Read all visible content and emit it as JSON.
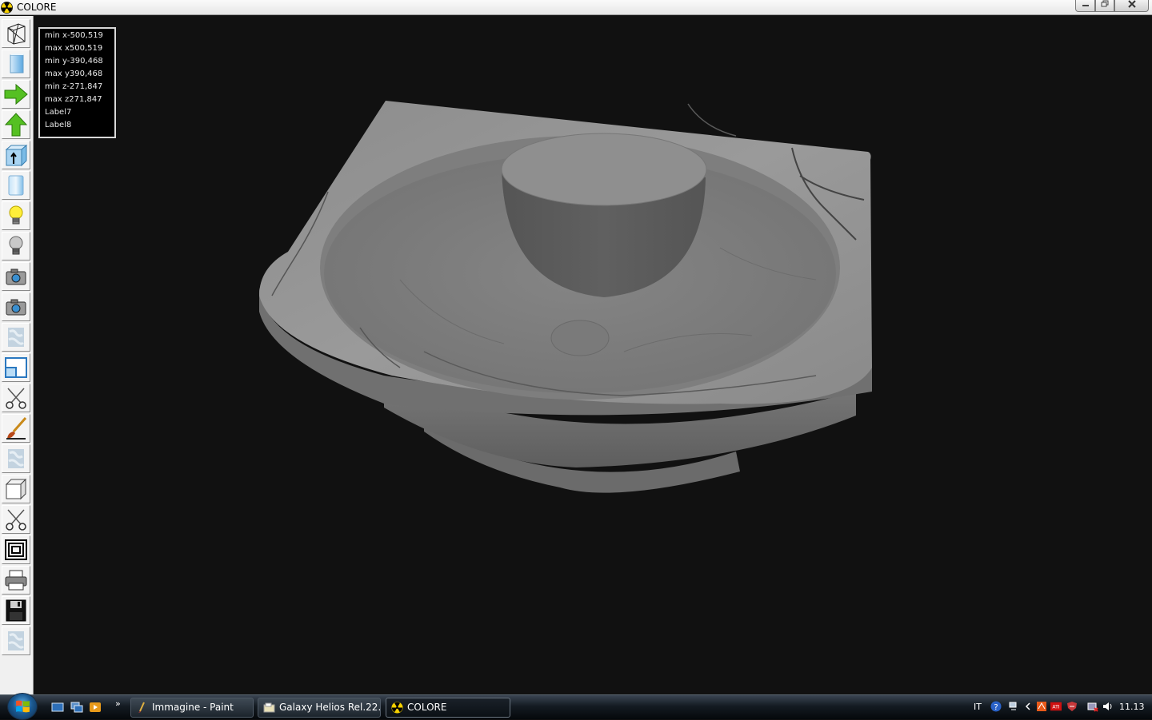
{
  "window": {
    "title": "COLORE"
  },
  "info_box": {
    "lines": [
      "min x-500,519",
      "max x500,519",
      "min y-390,468",
      "max y390,468",
      "min z-271,847",
      "max z271,847",
      "Label7",
      "Label8"
    ]
  },
  "toolbar": {
    "tools": [
      "wireframe-icon",
      "solid-box-icon",
      "arrow-right-icon",
      "arrow-up-icon",
      "box-arrow-icon",
      "cylinder-icon",
      "light-bulb-on-icon",
      "light-bulb-off-icon",
      "camera-icon",
      "camera-2-icon",
      "texture-icon",
      "window-split-icon",
      "scissors-icon",
      "brush-icon",
      "texture-2-icon",
      "cube-icon",
      "scissors-2-icon",
      "frames-icon",
      "printer-icon",
      "floppy-disk-icon",
      "texture-3-icon"
    ]
  },
  "taskbar": {
    "tasks": [
      {
        "label": "Immagine - Paint"
      },
      {
        "label": "Galaxy Helios  Rel.22..."
      },
      {
        "label": "COLORE"
      }
    ],
    "language": "IT",
    "clock": "11.13"
  }
}
